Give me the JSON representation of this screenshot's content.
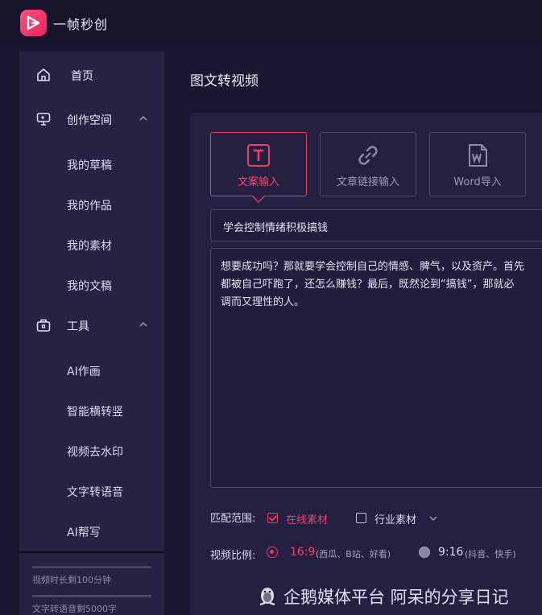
{
  "app": {
    "name": "一帧秒创"
  },
  "sidebar": {
    "home": "首页",
    "create_space": "创作空间",
    "create_items": [
      "我的草稿",
      "我的作品",
      "我的素材",
      "我的文稿"
    ],
    "tools": "工具",
    "tool_items": [
      "AI作画",
      "智能横转竖",
      "视频去水印",
      "文字转语音",
      "AI帮写"
    ],
    "quota": [
      {
        "label": "视频时长",
        "value": "剩100分钟"
      },
      {
        "label": "文字转语音",
        "value": "剩5000字"
      }
    ]
  },
  "main": {
    "title": "图文转视频",
    "source_tabs": [
      {
        "label": "文案输入",
        "icon": "text-t-icon",
        "active": true
      },
      {
        "label": "文章链接输入",
        "icon": "link-icon",
        "active": false
      },
      {
        "label": "Word导入",
        "icon": "word-file-icon",
        "active": false
      }
    ],
    "title_value": "学会控制情绪积极搞钱",
    "body_lines": [
      "想要成功吗？那就要学会控制自己的情感、脾气，以及资产。首先",
      "都被自己吓跑了，还怎么赚钱？最后，既然论到“搞钱”，那就必",
      "调而又理性的人。"
    ],
    "match_label": "匹配范围:",
    "online_material": "在线素材",
    "industry_material": "行业素材",
    "ratio_label": "视频比例:",
    "ratio_169": "16:9",
    "ratio_169_note": "(西瓜、B站、好看)",
    "ratio_916": "9:16",
    "ratio_916_note": "(抖音、快手)"
  },
  "watermark": "企鹅媒体平台 阿呆的分享日记",
  "colors": {
    "accent": "#e63b63",
    "sidebar_bg": "#272244",
    "panel_bg": "#252041"
  }
}
